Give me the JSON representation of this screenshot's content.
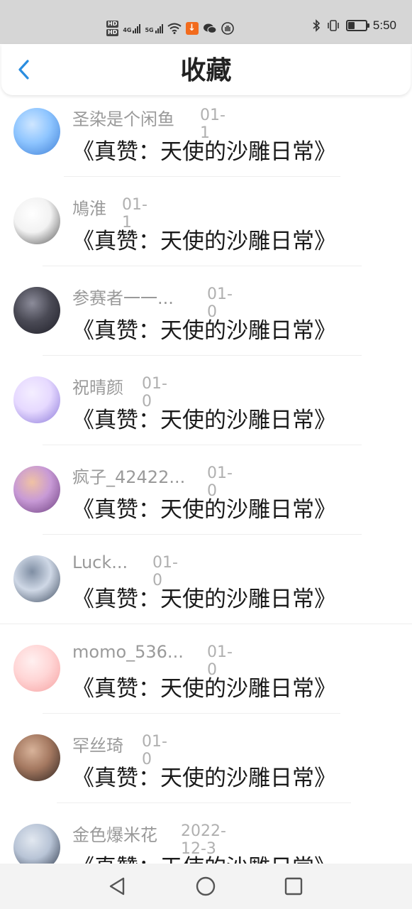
{
  "status_bar": {
    "time": "5:50",
    "hd1": "HD",
    "hd2": "HD",
    "net1": "4G",
    "net2": "5G",
    "icons": [
      "hd-icon",
      "signal-4g-icon",
      "signal-5g-icon",
      "wifi-icon",
      "download-icon",
      "wechat-icon",
      "shield-icon",
      "bluetooth-icon",
      "vibrate-icon",
      "battery-icon"
    ],
    "battery_level": 0.35
  },
  "header": {
    "title": "收藏",
    "back_icon": "chevron-left-icon",
    "accent_color": "#2a8de0"
  },
  "favorites": [
    {
      "user": "圣染是个闲鱼",
      "date": "01-1",
      "title": "《真赞：天使的沙雕日常》"
    },
    {
      "user": "鳩淮",
      "date": "01-1",
      "title": "《真赞：天使的沙雕日常》"
    },
    {
      "user": "参赛者一一...",
      "date": "01-0",
      "title": "《真赞：天使的沙雕日常》"
    },
    {
      "user": "祝晴颜",
      "date": "01-0",
      "title": "《真赞：天使的沙雕日常》"
    },
    {
      "user": "疯子_42422...",
      "date": "01-0",
      "title": "《真赞：天使的沙雕日常》"
    },
    {
      "user": "Luck...",
      "date": "01-0",
      "title": "《真赞：天使的沙雕日常》"
    },
    {
      "user": "momo_536...",
      "date": "01-0",
      "title": "《真赞：天使的沙雕日常》"
    },
    {
      "user": "罕丝琦",
      "date": "01-0",
      "title": "《真赞：天使的沙雕日常》"
    },
    {
      "user": "金色爆米花",
      "date": "2022-12-3",
      "title": "《真赞：天使的沙雕日常》"
    }
  ],
  "nav_bar": {
    "back_icon": "triangle-back-icon",
    "home_icon": "circle-home-icon",
    "recents_icon": "square-recents-icon"
  }
}
